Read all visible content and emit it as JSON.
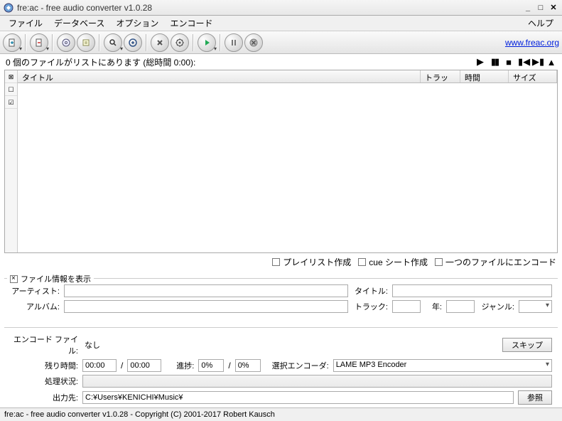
{
  "titlebar": {
    "title": "fre:ac - free audio converter v1.0.28"
  },
  "menubar": {
    "file": "ファイル",
    "database": "データベース",
    "options": "オプション",
    "encode": "エンコード",
    "help": "ヘルプ"
  },
  "toolbar": {
    "link_text": "www.freac.org"
  },
  "status": {
    "text": "0 個のファイルがリストにあります (総時間 0:00):"
  },
  "table": {
    "headers": {
      "title": "タイトル",
      "track": "トラック",
      "time": "時間",
      "size": "サイズ"
    }
  },
  "options": {
    "playlist": "プレイリスト作成",
    "cuesheet": "cue シート作成",
    "singlefile": "一つのファイルにエンコード"
  },
  "fileinfo": {
    "group_label": "ファイル情報を表示",
    "artist_label": "アーティスト:",
    "artist": "",
    "album_label": "アルバム:",
    "album": "",
    "title_label": "タイトル:",
    "title": "",
    "track_label": "トラック:",
    "track": "",
    "year_label": "年:",
    "year": "",
    "genre_label": "ジャンル:",
    "genre": ""
  },
  "encode": {
    "file_label": "エンコード ファイル:",
    "file": "なし",
    "skip_label": "スキップ",
    "elapsed_label": "残り時間:",
    "elapsed": "00:00",
    "total": "00:00",
    "progress_label": "進捗:",
    "progress1": "0%",
    "progress2": "0%",
    "encoder_label": "選択エンコーダ:",
    "encoder": "LAME MP3 Encoder",
    "state_label": "処理状況:",
    "state": "",
    "output_label": "出力先:",
    "output": "C:¥Users¥KENICHI¥Music¥",
    "browse_label": "参照"
  },
  "footer": {
    "text": "fre:ac - free audio converter v1.0.28 - Copyright (C) 2001-2017 Robert Kausch"
  }
}
